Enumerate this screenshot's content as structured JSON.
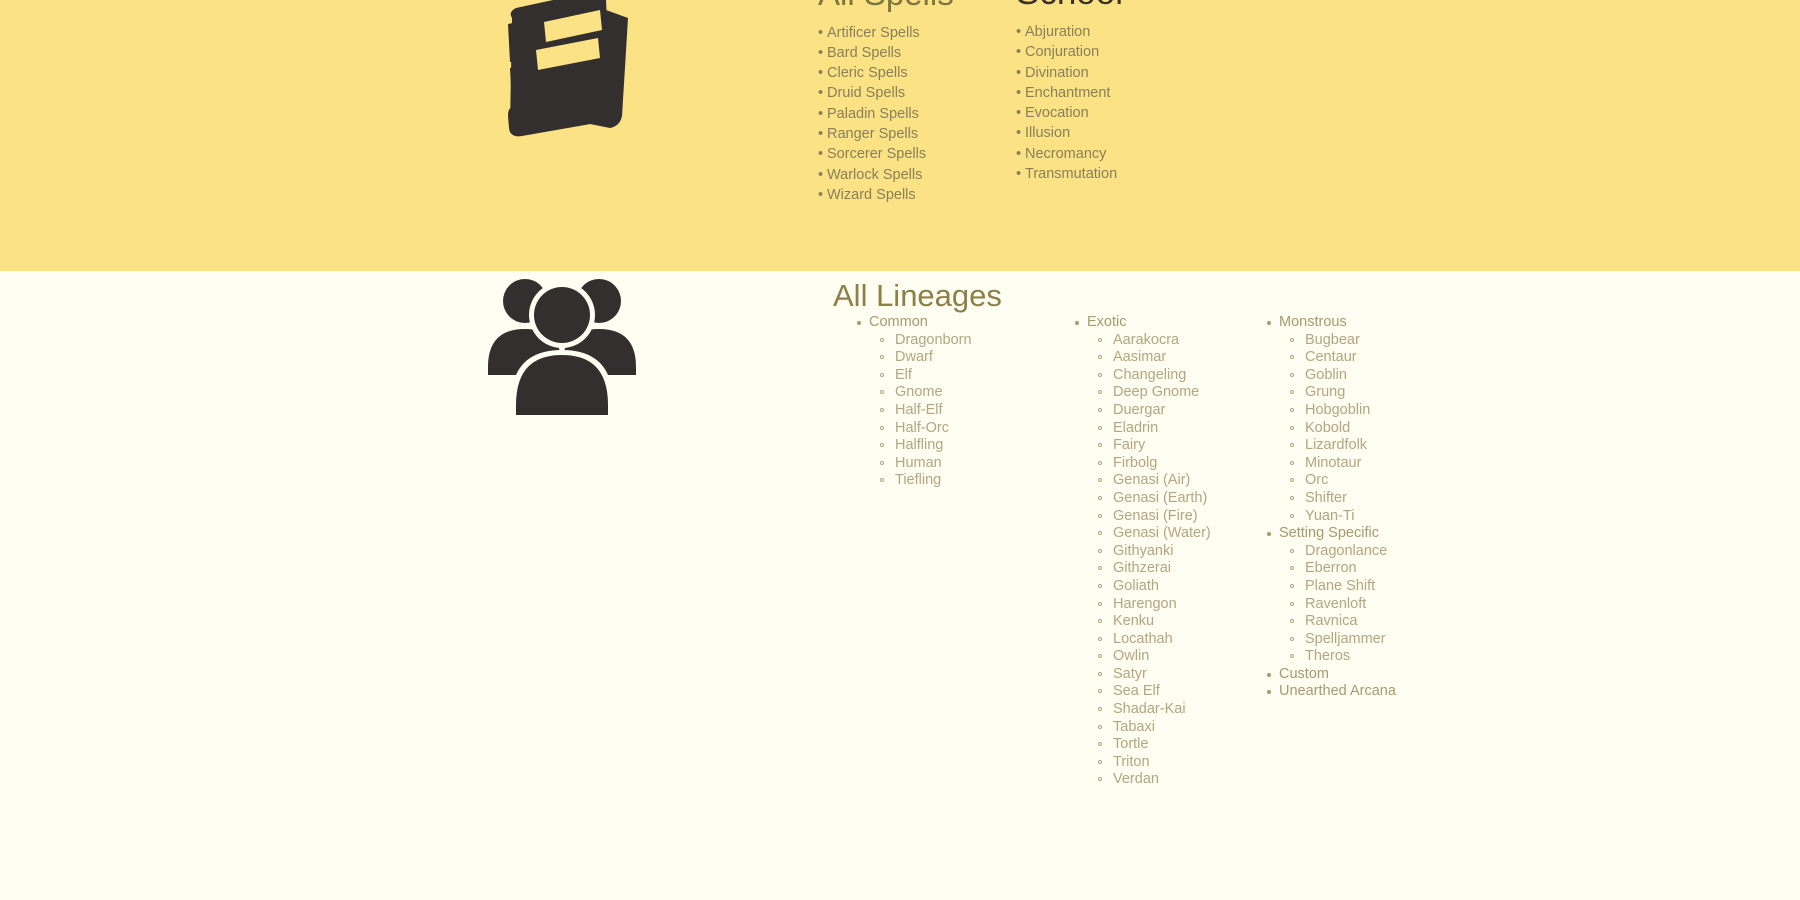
{
  "theme": {
    "spells_band_bg": "#fbe285",
    "lineages_band_bg": "#fdfdf1",
    "heading_olive": "#7f7540",
    "heading_dark": "#3b3225",
    "list_text": "#8a7f59",
    "lineage_text": "#b3a680",
    "icon_color": "#332f2e"
  },
  "spells_section": {
    "icon": "spellbook-icon",
    "all_spells": {
      "heading": "All Spells",
      "items": [
        "Artificer Spells",
        "Bard Spells",
        "Cleric Spells",
        "Druid Spells",
        "Paladin Spells",
        "Ranger Spells",
        "Sorcerer Spells",
        "Warlock Spells",
        "Wizard Spells"
      ]
    },
    "school": {
      "heading": "School",
      "items": [
        "Abjuration",
        "Conjuration",
        "Divination",
        "Enchantment",
        "Evocation",
        "Illusion",
        "Necromancy",
        "Transmutation"
      ]
    }
  },
  "lineages_section": {
    "icon": "people-group-icon",
    "heading": "All Lineages",
    "columns": [
      {
        "name": "common-column",
        "groups": [
          {
            "label": "Common",
            "items": [
              "Dragonborn",
              "Dwarf",
              "Elf",
              "Gnome",
              "Half-Elf",
              "Half-Orc",
              "Halfling",
              "Human",
              "Tiefling"
            ]
          }
        ]
      },
      {
        "name": "exotic-column",
        "groups": [
          {
            "label": "Exotic",
            "items": [
              "Aarakocra",
              "Aasimar",
              "Changeling",
              "Deep Gnome",
              "Duergar",
              "Eladrin",
              "Fairy",
              "Firbolg",
              "Genasi (Air)",
              "Genasi (Earth)",
              "Genasi (Fire)",
              "Genasi (Water)",
              "Githyanki",
              "Githzerai",
              "Goliath",
              "Harengon",
              "Kenku",
              "Locathah",
              "Owlin",
              "Satyr",
              "Sea Elf",
              "Shadar-Kai",
              "Tabaxi",
              "Tortle",
              "Triton",
              "Verdan"
            ]
          }
        ]
      },
      {
        "name": "monstrous-column",
        "groups": [
          {
            "label": "Monstrous",
            "items": [
              "Bugbear",
              "Centaur",
              "Goblin",
              "Grung",
              "Hobgoblin",
              "Kobold",
              "Lizardfolk",
              "Minotaur",
              "Orc",
              "Shifter",
              "Yuan-Ti"
            ]
          },
          {
            "label": "Setting Specific",
            "items": [
              "Dragonlance",
              "Eberron",
              "Plane Shift",
              "Ravenloft",
              "Ravnica",
              "Spelljammer",
              "Theros"
            ]
          },
          {
            "label": "Custom",
            "items": []
          },
          {
            "label": "Unearthed Arcana",
            "items": []
          }
        ]
      }
    ]
  }
}
